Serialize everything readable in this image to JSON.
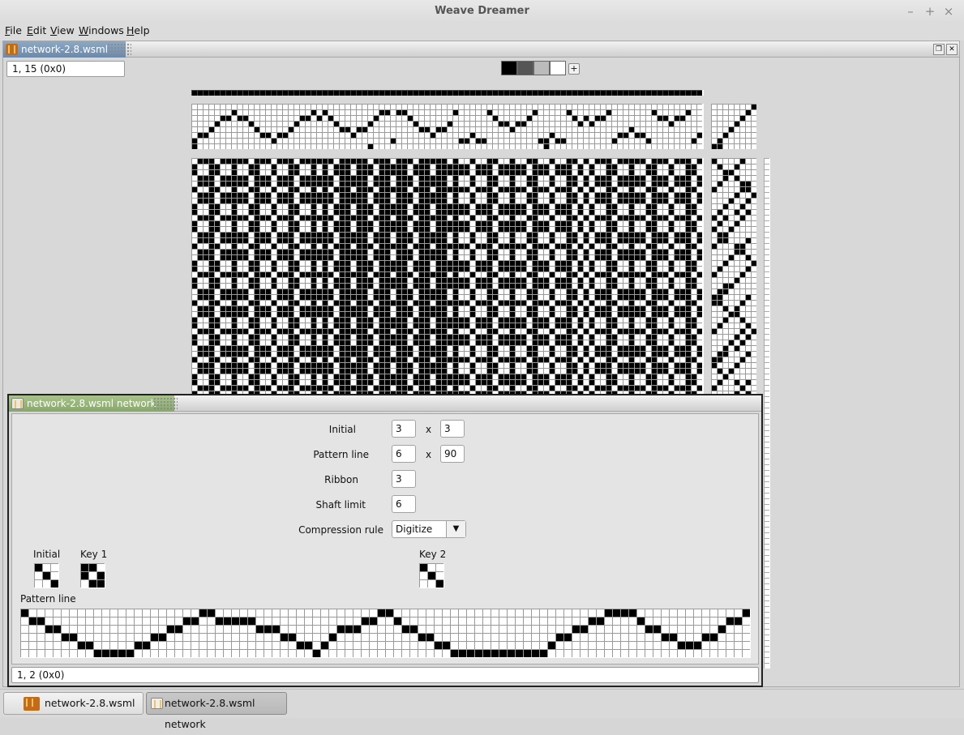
{
  "window": {
    "title": "Weave Dreamer"
  },
  "menu": [
    {
      "label": "File",
      "mnemonic": "F",
      "rest": "ile"
    },
    {
      "label": "Edit",
      "mnemonic": "E",
      "rest": "dit"
    },
    {
      "label": "View",
      "mnemonic": "V",
      "rest": "iew"
    },
    {
      "label": "Windows",
      "mnemonic": "W",
      "rest": "indows"
    },
    {
      "label": "Help",
      "mnemonic": "H",
      "rest": "elp"
    }
  ],
  "doc": {
    "title": "network-2.8.wsml",
    "status": "1, 15 (0x0)",
    "palette": [
      "#000000",
      "#555555",
      "#bbbbbb",
      "#ffffff"
    ]
  },
  "network": {
    "title": "network-2.8.wsml network",
    "fields": {
      "initial_label": "Initial",
      "initial_w": "3",
      "initial_h": "3",
      "pattern_label": "Pattern line",
      "pattern_w": "6",
      "pattern_h": "90",
      "ribbon_label": "Ribbon",
      "ribbon": "3",
      "shaft_label": "Shaft limit",
      "shaft": "6",
      "compression_label": "Compression rule",
      "compression": "Digitize"
    },
    "sep": "x",
    "labels": {
      "initial": "Initial",
      "key1": "Key 1",
      "key2": "Key 2",
      "pattern": "Pattern line"
    },
    "status": "1, 2 (0x0)"
  },
  "taskbar": [
    {
      "label": "network-2.8.wsml"
    },
    {
      "label": "network-2.8.wsml network"
    }
  ]
}
